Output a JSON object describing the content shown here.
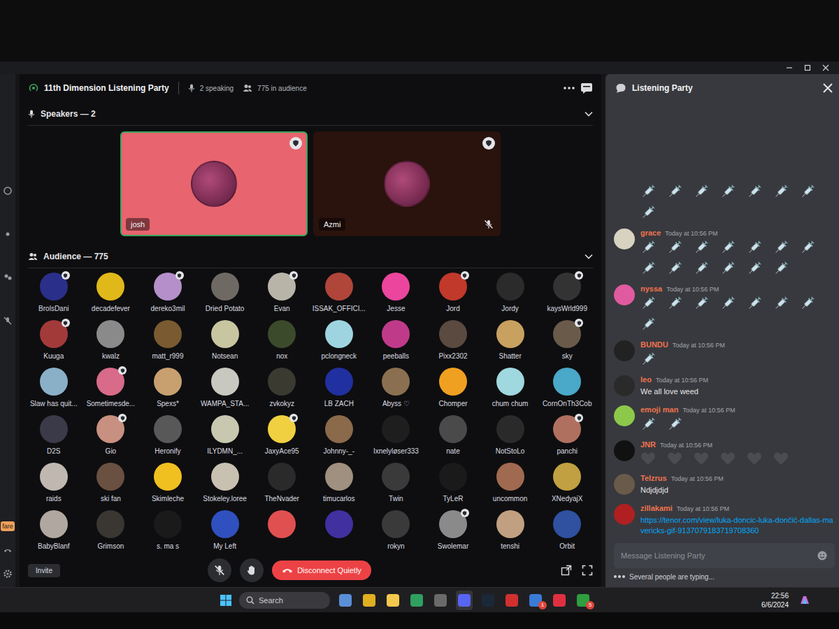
{
  "rail": {
    "label": "fare"
  },
  "stage": {
    "title": "11th Dimension Listening Party",
    "speaking": "2 speaking",
    "audience_count": "775 in audience"
  },
  "speakers": {
    "heading": "Speakers — 2",
    "items": [
      {
        "name": "josh",
        "speaking": true,
        "muted": false,
        "color": "#e8646f"
      },
      {
        "name": "Azmi",
        "speaking": false,
        "muted": true,
        "color": "#2a120d"
      }
    ]
  },
  "audience": {
    "heading": "Audience — 775",
    "members": [
      {
        "name": "BrolsDani",
        "badge": true,
        "color": "#2a2f8a"
      },
      {
        "name": "decadefever",
        "badge": false,
        "color": "#e0b81a"
      },
      {
        "name": "dereko3mil",
        "badge": true,
        "color": "#b58fc9"
      },
      {
        "name": "Dried Potato",
        "badge": false,
        "color": "#6e6a63"
      },
      {
        "name": "Evan",
        "badge": true,
        "color": "#b8b4a8"
      },
      {
        "name": "ISSAK_OFFICI...",
        "badge": false,
        "color": "#b0453a"
      },
      {
        "name": "Jesse",
        "badge": false,
        "color": "#eb459e"
      },
      {
        "name": "Jord",
        "badge": true,
        "color": "#c0392b"
      },
      {
        "name": "Jordy",
        "badge": false,
        "color": "#2b2b2b"
      },
      {
        "name": "kaysWrld999",
        "badge": true,
        "color": "#333333"
      },
      {
        "name": "Kuuga",
        "badge": true,
        "color": "#a33a3a"
      },
      {
        "name": "kwalz",
        "badge": false,
        "color": "#8a8a8a"
      },
      {
        "name": "matt_r999",
        "badge": false,
        "color": "#7a5a30"
      },
      {
        "name": "Notsean",
        "badge": false,
        "color": "#c8c6a0"
      },
      {
        "name": "nox",
        "badge": false,
        "color": "#3c4a2c"
      },
      {
        "name": "pclongneck",
        "badge": false,
        "color": "#9ed4e0"
      },
      {
        "name": "peeballs",
        "badge": false,
        "color": "#c03a8a"
      },
      {
        "name": "Pixx2302",
        "badge": false,
        "color": "#5a4a40"
      },
      {
        "name": "Shatter",
        "badge": false,
        "color": "#c8a060"
      },
      {
        "name": "sky",
        "badge": true,
        "color": "#6a5a4a"
      },
      {
        "name": "Slaw has quit...",
        "badge": false,
        "color": "#8ab0c8"
      },
      {
        "name": "Sometimesde...",
        "badge": true,
        "color": "#d86a8a"
      },
      {
        "name": "Spexs*",
        "badge": false,
        "color": "#c8a070"
      },
      {
        "name": "WAMPA_STA...",
        "badge": false,
        "color": "#c8c8c0"
      },
      {
        "name": "zvkokyz",
        "badge": false,
        "color": "#3a3a30"
      },
      {
        "name": "LB ZACH",
        "badge": false,
        "color": "#2030a0"
      },
      {
        "name": "Abyss ♡",
        "badge": false,
        "color": "#8a7050"
      },
      {
        "name": "Chomper",
        "badge": false,
        "color": "#f0a020"
      },
      {
        "name": "chum chum",
        "badge": false,
        "color": "#a0d8e0"
      },
      {
        "name": "CornOnTh3Cob",
        "badge": false,
        "color": "#4aa8c8"
      },
      {
        "name": "D2S",
        "badge": false,
        "color": "#3a3a48"
      },
      {
        "name": "Gio",
        "badge": true,
        "color": "#c89080"
      },
      {
        "name": "Heronify",
        "badge": false,
        "color": "#585858"
      },
      {
        "name": "ILYDMN_...",
        "badge": false,
        "color": "#c8c8b0"
      },
      {
        "name": "JaxyAce95",
        "badge": true,
        "color": "#f0d040"
      },
      {
        "name": "Johnny-_-",
        "badge": false,
        "color": "#8a6a4a"
      },
      {
        "name": "Ixnelyløser333",
        "badge": false,
        "color": "#1e1e1e"
      },
      {
        "name": "nate",
        "badge": false,
        "color": "#4a4a4a"
      },
      {
        "name": "NotStoLo",
        "badge": false,
        "color": "#2a2a2a"
      },
      {
        "name": "panchi",
        "badge": true,
        "color": "#b07060"
      },
      {
        "name": "raids",
        "badge": false,
        "color": "#c0b8b0"
      },
      {
        "name": "ski fan",
        "badge": false,
        "color": "#6a5040"
      },
      {
        "name": "Skimleche",
        "badge": false,
        "color": "#f0c020"
      },
      {
        "name": "Stokeley.loree",
        "badge": false,
        "color": "#c8c0b0"
      },
      {
        "name": "TheNvader",
        "badge": false,
        "color": "#2a2a2a"
      },
      {
        "name": "timucarlos",
        "badge": false,
        "color": "#a09080"
      },
      {
        "name": "Twin",
        "badge": false,
        "color": "#3a3a3a"
      },
      {
        "name": "TyLeR",
        "badge": false,
        "color": "#1a1a1a"
      },
      {
        "name": "uncommon",
        "badge": false,
        "color": "#a06a50"
      },
      {
        "name": "XNedyajX",
        "badge": false,
        "color": "#c0a040"
      },
      {
        "name": "BabyBlanf",
        "badge": false,
        "color": "#b0a8a0"
      },
      {
        "name": "Grimson",
        "badge": false,
        "color": "#3a3632"
      },
      {
        "name": "s. ma s",
        "badge": false,
        "color": "#1a1a1a"
      },
      {
        "name": "My Left",
        "badge": false,
        "color": "#3050c0"
      },
      {
        "badge": false,
        "color": "#e05050"
      },
      {
        "badge": false,
        "color": "#4030a0"
      },
      {
        "name": "rokyn",
        "badge": false,
        "color": "#3a3a3a"
      },
      {
        "name": "Swolemar",
        "badge": true,
        "color": "#8a8a8a"
      },
      {
        "name": "tenshi",
        "badge": false,
        "color": "#c0a080"
      },
      {
        "name": "Orbit",
        "badge": false,
        "color": "#3050a0"
      }
    ]
  },
  "controls": {
    "invite": "Invite",
    "disconnect": "Disconnect Quietly"
  },
  "chat": {
    "title": "Listening Party",
    "messages": [
      {
        "kind": "emoji-syringe",
        "count": 8
      },
      {
        "author": "grace",
        "time": "Today at 10:56 PM",
        "kind": "emoji-syringe",
        "count": 13,
        "color": "#d8d2c0"
      },
      {
        "author": "nyssa",
        "time": "Today at 10:56 PM",
        "kind": "emoji-syringe",
        "count": 8,
        "color": "#e05aa0"
      },
      {
        "author": "BUNDU",
        "time": "Today at 10:56 PM",
        "kind": "emoji-syringe",
        "count": 1,
        "color": "#222222"
      },
      {
        "author": "leo",
        "time": "Today at 10:56 PM",
        "kind": "text",
        "text": "We all love weed",
        "color": "#2a2a2a"
      },
      {
        "author": "emoji man",
        "time": "Today at 10:56 PM",
        "kind": "emoji-syringe",
        "count": 2,
        "color": "#8cc84a"
      },
      {
        "author": "JNR",
        "time": "Today at 10:56 PM",
        "kind": "emoji-heart",
        "count": 6,
        "color": "#111111"
      },
      {
        "author": "Telzrus",
        "time": "Today at 10:56 PM",
        "kind": "text",
        "text": "Ndjdjdjd",
        "color": "#6a5a4a"
      },
      {
        "author": "zillakami",
        "time": "Today at 10:56 PM",
        "kind": "link",
        "text": "https://tenor.com/view/luka-doncic-luka-dončić-dallas-mavericks-gif-9137079183719708360",
        "color": "#b02020"
      }
    ],
    "input": {
      "placeholder": "Message Listening Party"
    },
    "typing": "Several people are typing..."
  },
  "taskbar": {
    "search": "Search",
    "apps": [
      {
        "color": "#5a8fd8",
        "selected": false
      },
      {
        "color": "#e0b020",
        "selected": false
      },
      {
        "color": "#f2c94c",
        "selected": false
      },
      {
        "color": "#2fa060",
        "selected": false
      },
      {
        "color": "#6a6a6a",
        "selected": false
      },
      {
        "color": "#5865f2",
        "selected": true
      },
      {
        "color": "#1b2838",
        "selected": false
      },
      {
        "color": "#d03030",
        "selected": false
      },
      {
        "color": "#3a7bd5",
        "selected": false,
        "badge": "1"
      },
      {
        "color": "#e03040",
        "selected": false
      },
      {
        "color": "#2e9e3e",
        "selected": false,
        "badge": "5"
      }
    ],
    "clock": {
      "time": "22:56",
      "date": "6/6/2024"
    }
  }
}
